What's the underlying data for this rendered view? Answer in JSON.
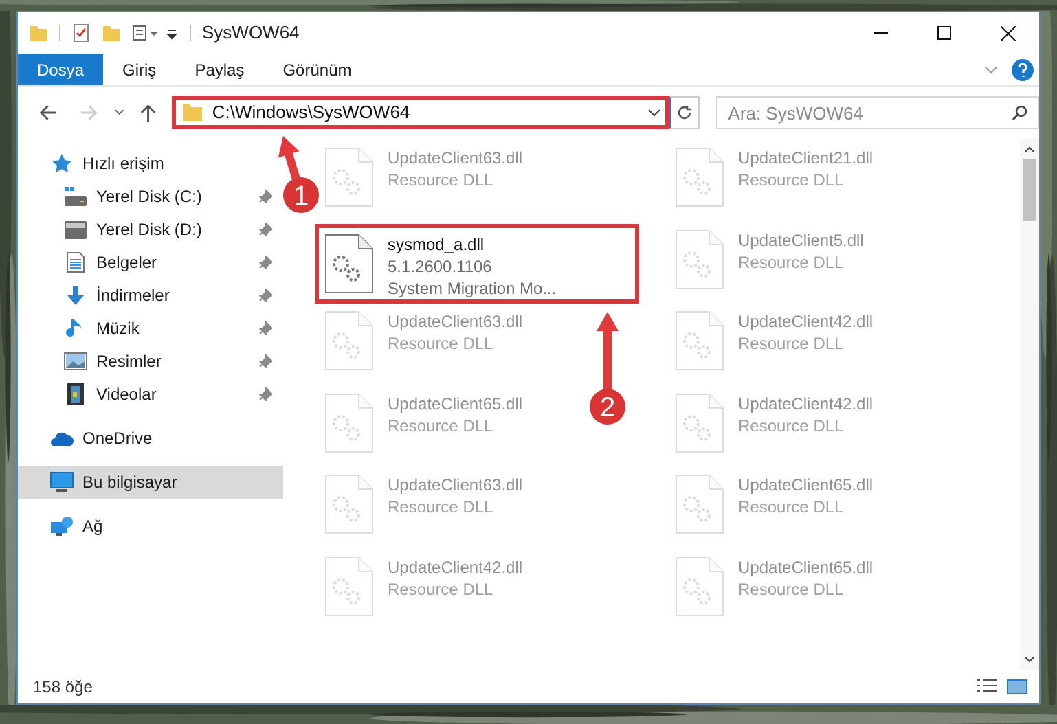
{
  "window": {
    "title": "SysWOW64"
  },
  "ribbon_tabs": [
    {
      "label": "Dosya",
      "selected": true
    },
    {
      "label": "Giriş",
      "selected": false
    },
    {
      "label": "Paylaş",
      "selected": false
    },
    {
      "label": "Görünüm",
      "selected": false
    }
  ],
  "address_bar": {
    "path": "C:\\Windows\\SysWOW64"
  },
  "search": {
    "placeholder": "Ara: SysWOW64"
  },
  "sidebar": {
    "items": [
      {
        "label": "Hızlı erişim",
        "kind": "star",
        "selected": false,
        "children": [
          {
            "label": "Yerel Disk (C:)",
            "kind": "sysdrive",
            "pinned": true
          },
          {
            "label": "Yerel Disk (D:)",
            "kind": "drive",
            "pinned": true
          },
          {
            "label": "Belgeler",
            "kind": "documents",
            "pinned": true
          },
          {
            "label": "İndirmeler",
            "kind": "download",
            "pinned": true
          },
          {
            "label": "Müzik",
            "kind": "music",
            "pinned": true
          },
          {
            "label": "Resimler",
            "kind": "pictures",
            "pinned": true
          },
          {
            "label": "Videolar",
            "kind": "videos",
            "pinned": true
          }
        ]
      },
      {
        "label": "OneDrive",
        "kind": "cloud",
        "selected": false
      },
      {
        "label": "Bu bilgisayar",
        "kind": "computer",
        "selected": true
      },
      {
        "label": "Ağ",
        "kind": "network",
        "selected": false
      }
    ]
  },
  "files": [
    {
      "name": "UpdateClient63.dll",
      "lines": [
        "Resource DLL"
      ],
      "dimmed": true
    },
    {
      "name": "UpdateClient21.dll",
      "lines": [
        "Resource DLL"
      ],
      "dimmed": true
    },
    {
      "name": "sysmod_a.dll",
      "lines": [
        "5.1.2600.1106",
        "System Migration Mo..."
      ],
      "dimmed": false
    },
    {
      "name": "UpdateClient5.dll",
      "lines": [
        "Resource DLL"
      ],
      "dimmed": true
    },
    {
      "name": "UpdateClient63.dll",
      "lines": [
        "Resource DLL"
      ],
      "dimmed": true
    },
    {
      "name": "UpdateClient42.dll",
      "lines": [
        "Resource DLL"
      ],
      "dimmed": true
    },
    {
      "name": "UpdateClient65.dll",
      "lines": [
        "Resource DLL"
      ],
      "dimmed": true
    },
    {
      "name": "UpdateClient42.dll",
      "lines": [
        "Resource DLL"
      ],
      "dimmed": true
    },
    {
      "name": "UpdateClient63.dll",
      "lines": [
        "Resource DLL"
      ],
      "dimmed": true
    },
    {
      "name": "UpdateClient65.dll",
      "lines": [
        "Resource DLL"
      ],
      "dimmed": true
    },
    {
      "name": "UpdateClient42.dll",
      "lines": [
        "Resource DLL"
      ],
      "dimmed": true
    },
    {
      "name": "UpdateClient65.dll",
      "lines": [
        "Resource DLL"
      ],
      "dimmed": true
    }
  ],
  "callouts": [
    {
      "number": "1"
    },
    {
      "number": "2"
    }
  ],
  "status_bar": {
    "item_count": "158 öğe"
  }
}
